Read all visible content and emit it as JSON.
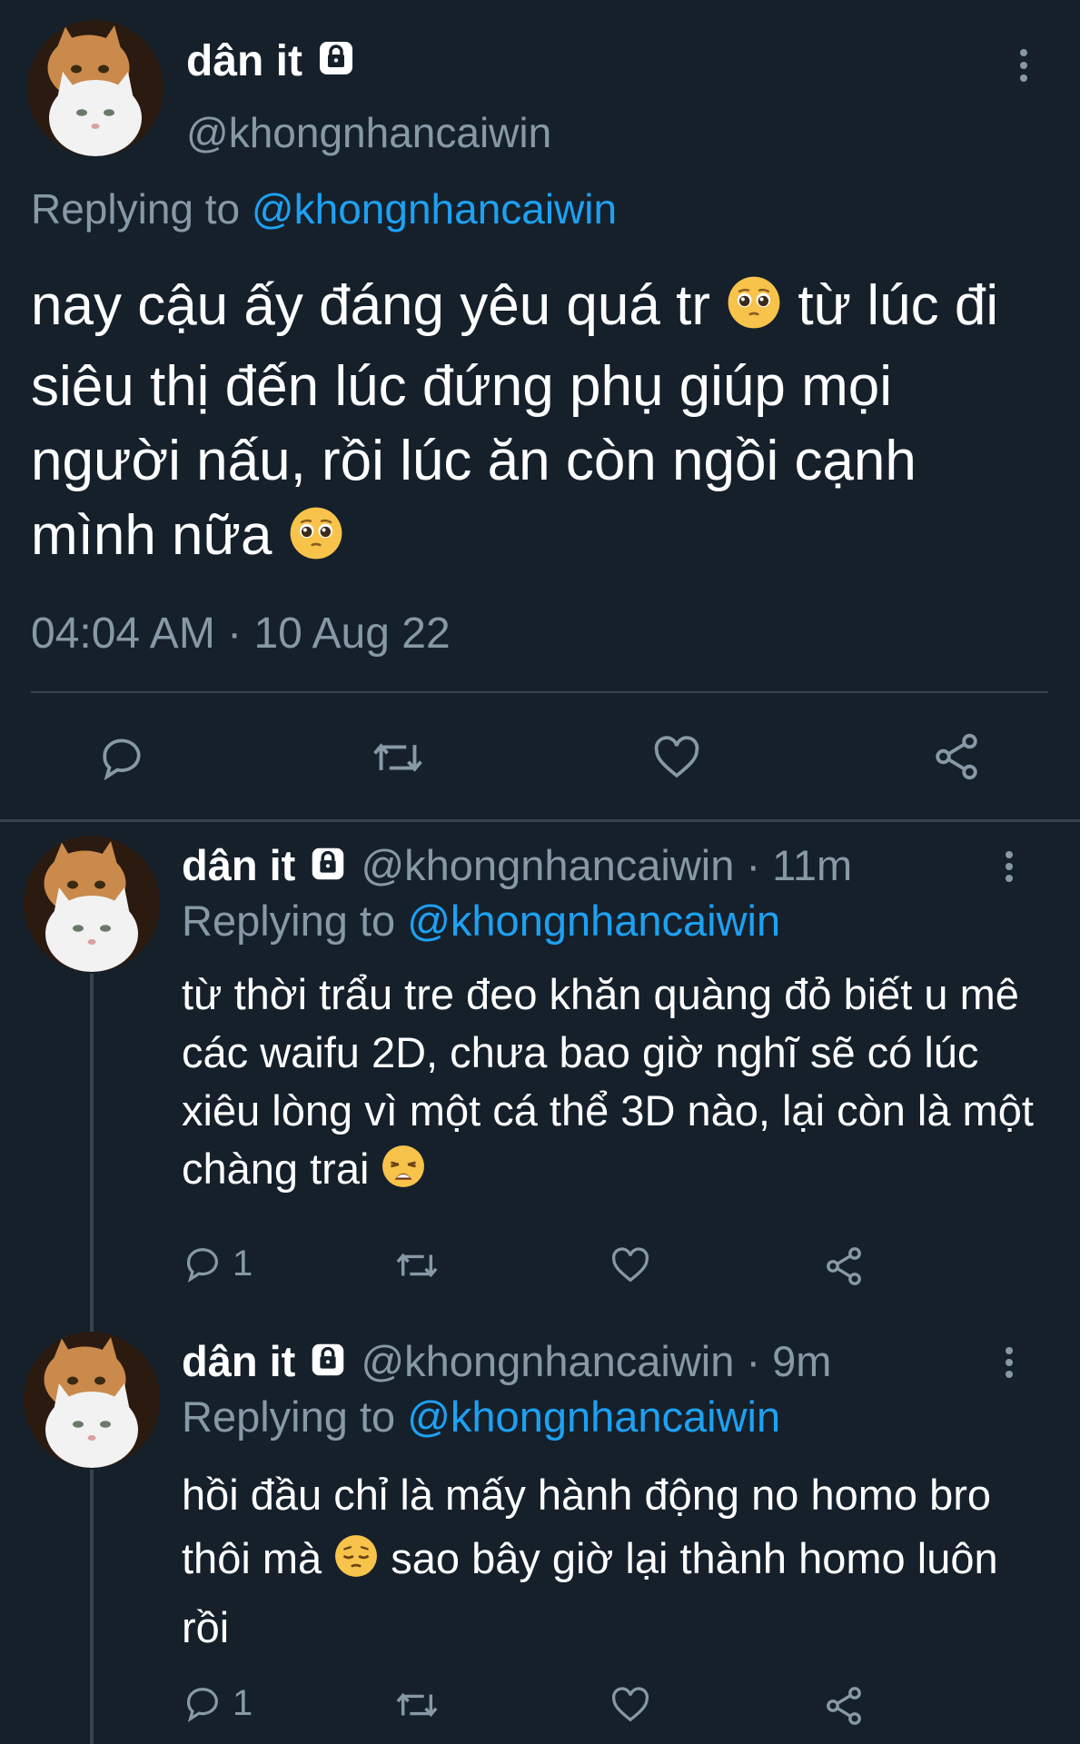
{
  "main_tweet": {
    "display_name": "dân it",
    "handle": "@khongnhancaiwin",
    "replying_label": "Replying to",
    "replying_handle": "@khongnhancaiwin",
    "text_parts": [
      "nay cậu ấy đáng yêu quá tr ",
      " từ lúc đi siêu thị đến lúc đứng phụ giúp mọi người nấu, rồi lúc ăn còn ngồi cạnh mình nữa "
    ],
    "timestamp": "04:04 AM · 10 Aug 22",
    "emoji": "pleading-face"
  },
  "replies": [
    {
      "display_name": "dân it",
      "handle": "@khongnhancaiwin",
      "time": "· 11m",
      "replying_label": "Replying to",
      "replying_handle": "@khongnhancaiwin",
      "text_parts": [
        "từ thời trẩu tre đeo khăn quàng đỏ biết u mê các waifu 2D, chưa bao giờ nghĩ sẽ có lúc xiêu lòng vì một cá thể 3D nào, lại còn là một chàng trai "
      ],
      "reply_count": "1",
      "emoji": "weary-face"
    },
    {
      "display_name": "dân it",
      "handle": "@khongnhancaiwin",
      "time": "· 9m",
      "replying_label": "Replying to",
      "replying_handle": "@khongnhancaiwin",
      "text_parts": [
        "hồi đầu chỉ là mấy hành động no homo bro thôi mà ",
        " sao bây giờ lại thành homo luôn rồi"
      ],
      "reply_count": "1",
      "emoji": "pensive-face"
    }
  ],
  "colors": {
    "background": "#15202b",
    "text": "#ffffff",
    "muted": "#8899a6",
    "link": "#1da1f2",
    "divider": "#38444d"
  }
}
